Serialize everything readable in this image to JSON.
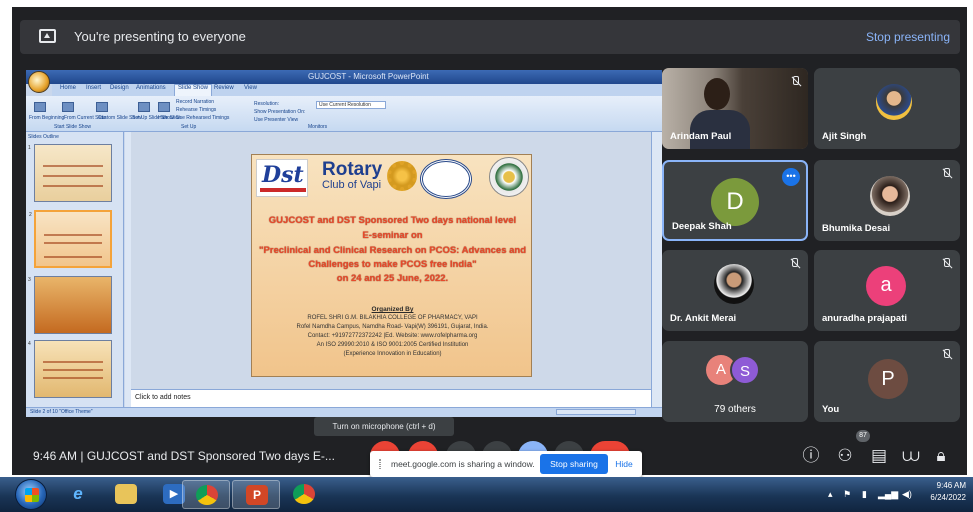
{
  "banner": {
    "presenting_text": "You're presenting to everyone",
    "stop_presenting": "Stop presenting"
  },
  "ppt": {
    "window_title": "GUJCOST - Microsoft PowerPoint",
    "tabs": [
      "Home",
      "Insert",
      "Design",
      "Animations",
      "Slide Show",
      "Review",
      "View"
    ],
    "ribbon": {
      "from_beginning": "From Beginning",
      "from_current": "From Current Slide",
      "custom_show": "Custom Slide Show",
      "group_start": "Start Slide Show",
      "set_up": "Set Up Slide Show",
      "hide": "Hide Slide",
      "record_narration": "Record Narration",
      "rehearse": "Rehearse Timings",
      "use_timings": "Use Rehearsed Timings",
      "group_setup": "Set Up",
      "resolution": "Resolution:",
      "resolution_value": "Use Current Resolution",
      "show_on": "Show Presentation On:",
      "presenter_view": "Use Presenter View",
      "group_monitors": "Monitors"
    },
    "sidebar_tabs": "Slides   Outline",
    "thumb_numbers": [
      "1",
      "2",
      "3",
      "4"
    ],
    "notes_placeholder": "Click to add notes",
    "status_text": "Slide 2 of 10    \"Office Theme\"",
    "slide": {
      "dst": "Dst",
      "rotary": "Rotary",
      "club": "Club of Vapi",
      "heading1": "GUJCOST and DST Sponsored Two days national level",
      "heading2": "E-seminar on",
      "heading3": "\"Preclinical and Clinical Research on PCOS: Advances and",
      "heading4": "Challenges to make PCOS free India\"",
      "heading5": "on 24 and 25 June, 2022.",
      "organized_by": "Organized By",
      "college": "ROFEL SHRI G.M. BILAKHIA COLLEGE OF PHARMACY, VAPI",
      "campus": "Rofel Namdha Campus, Namdha Road- Vapi(W) 396191, Gujarat, India.",
      "contact": "Contact: +91972772372242 |Ed. Website: www.rofelpharma.org",
      "iso": "An ISO 29990:2010 & ISO 9001:2005 Certified Institution",
      "experience": "(Experience Innovation in Education)"
    }
  },
  "participants": {
    "arindam": "Arindam Paul",
    "ajit": "Ajit Singh",
    "deepak": "Deepak Shah",
    "deepak_initial": "D",
    "bhumika": "Bhumika Desai",
    "ankit": "Dr. Ankit Merai",
    "anuradha": "anuradha prajapati",
    "anuradha_initial": "a",
    "others_a": "A",
    "others_s": "S",
    "others": "79 others",
    "you": "You",
    "you_initial": "P",
    "more_glyph": "•••"
  },
  "bottom_bar": {
    "meeting_info": "9:46 AM  |  GUJCOST and DST Sponsored Two days E-...",
    "mic_tooltip": "Turn on microphone (ctrl + d)",
    "people_count": "87",
    "info_icon": "info-icon",
    "people_icon": "people-icon",
    "chat_icon": "chat-icon",
    "activities_icon": "activities-icon",
    "lock_icon": "host-controls-icon"
  },
  "share_notice": {
    "text": "meet.google.com is sharing a window.",
    "stop_sharing": "Stop sharing",
    "hide": "Hide"
  },
  "taskbar": {
    "clock_time": "9:46 AM",
    "clock_date": "6/24/2022"
  },
  "colors": {
    "meet_bg": "#202124",
    "tile_bg": "#3c4043",
    "accent_blue": "#8ab4f8",
    "stop_sharing_blue": "#1a73e8",
    "avatar_deepak": "#7b9a3c",
    "avatar_anuradha": "#ec407a",
    "avatar_you": "#6d4c41",
    "avatar_a": "#e8827a",
    "avatar_s": "#8e5bd6"
  }
}
